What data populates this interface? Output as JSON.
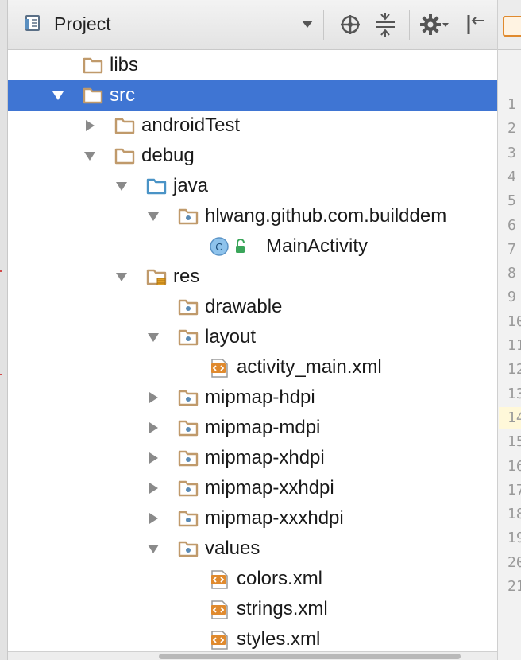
{
  "toolbar": {
    "title": "Project",
    "icons": [
      "project-view-icon",
      "dropdown-arrow-icon",
      "locate-icon",
      "collapse-all-icon",
      "settings-gear-icon",
      "hide-panel-icon"
    ]
  },
  "tree": [
    {
      "label": "libs",
      "depth": 1,
      "expanded": null,
      "kind": "folder",
      "selected": false
    },
    {
      "label": "src",
      "depth": 1,
      "expanded": true,
      "kind": "folder",
      "selected": true
    },
    {
      "label": "androidTest",
      "depth": 2,
      "expanded": false,
      "kind": "folder",
      "selected": false
    },
    {
      "label": "debug",
      "depth": 2,
      "expanded": true,
      "kind": "folder",
      "selected": false
    },
    {
      "label": "java",
      "depth": 3,
      "expanded": true,
      "kind": "source-folder",
      "selected": false
    },
    {
      "label": "hlwang.github.com.builddem",
      "depth": 4,
      "expanded": true,
      "kind": "package",
      "selected": false
    },
    {
      "label": "MainActivity",
      "depth": 5,
      "expanded": null,
      "kind": "class",
      "selected": false
    },
    {
      "label": "res",
      "depth": 3,
      "expanded": true,
      "kind": "res-folder",
      "selected": false
    },
    {
      "label": "drawable",
      "depth": 4,
      "expanded": null,
      "kind": "package",
      "selected": false
    },
    {
      "label": "layout",
      "depth": 4,
      "expanded": true,
      "kind": "package",
      "selected": false
    },
    {
      "label": "activity_main.xml",
      "depth": 5,
      "expanded": null,
      "kind": "xml",
      "selected": false
    },
    {
      "label": "mipmap-hdpi",
      "depth": 4,
      "expanded": false,
      "kind": "package",
      "selected": false
    },
    {
      "label": "mipmap-mdpi",
      "depth": 4,
      "expanded": false,
      "kind": "package",
      "selected": false
    },
    {
      "label": "mipmap-xhdpi",
      "depth": 4,
      "expanded": false,
      "kind": "package",
      "selected": false
    },
    {
      "label": "mipmap-xxhdpi",
      "depth": 4,
      "expanded": false,
      "kind": "package",
      "selected": false
    },
    {
      "label": "mipmap-xxxhdpi",
      "depth": 4,
      "expanded": false,
      "kind": "package",
      "selected": false
    },
    {
      "label": "values",
      "depth": 4,
      "expanded": true,
      "kind": "package",
      "selected": false
    },
    {
      "label": "colors.xml",
      "depth": 5,
      "expanded": null,
      "kind": "xml",
      "selected": false
    },
    {
      "label": "strings.xml",
      "depth": 5,
      "expanded": null,
      "kind": "xml",
      "selected": false
    },
    {
      "label": "styles.xml",
      "depth": 5,
      "expanded": null,
      "kind": "xml",
      "selected": false
    }
  ],
  "gutter": [
    "1",
    "2",
    "3",
    "4",
    "5",
    "6",
    "7",
    "8",
    "9",
    "10",
    "11",
    "12",
    "13",
    "14",
    "15",
    "16",
    "17",
    "18",
    "19",
    "20",
    "21"
  ],
  "gutter_highlight": "14",
  "colors": {
    "selection": "#3f75d3",
    "folder": "#c09a6b",
    "source_folder": "#4a93c6",
    "class_icon": "#8ec3ec",
    "xml_icon": "#e08a2e",
    "unlocked": "#3aa55a"
  }
}
